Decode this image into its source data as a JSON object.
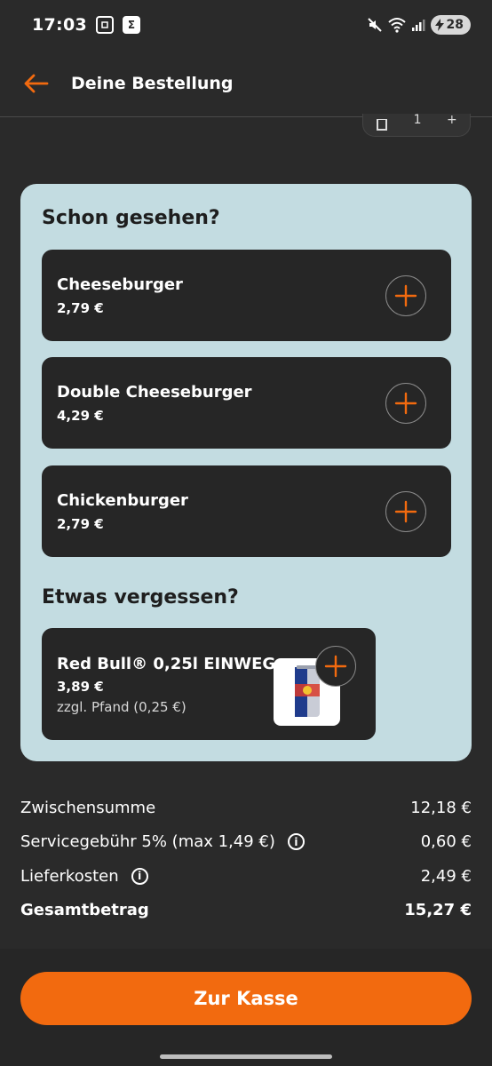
{
  "status_bar": {
    "time": "17:03",
    "battery": "28",
    "notif_icon_1": "screenshot-icon",
    "notif_icon_2": "sigma-icon"
  },
  "header": {
    "title": "Deine Bestellung"
  },
  "qty_control": {
    "value": "1",
    "minus": "-",
    "plus": "+"
  },
  "upsell": {
    "title": "Schon gesehen?",
    "items": [
      {
        "name": "Cheeseburger",
        "price": "2,79 €"
      },
      {
        "name": "Double Cheeseburger",
        "price": "4,29 €"
      },
      {
        "name": "Chickenburger",
        "price": "2,79 €"
      }
    ]
  },
  "forgot": {
    "title": "Etwas vergessen?",
    "item": {
      "name": "Red Bull® 0,25l EINWEG",
      "price": "3,89 €",
      "deposit": "zzgl. Pfand (0,25 €)"
    }
  },
  "totals": {
    "subtotal_label": "Zwischensumme",
    "subtotal_value": "12,18 €",
    "service_label": "Servicegebühr 5% (max 1,49 €)",
    "service_value": "0,60 €",
    "delivery_label": "Lieferkosten",
    "delivery_value": "2,49 €",
    "total_label": "Gesamtbetrag",
    "total_value": "15,27 €"
  },
  "checkout": {
    "label": "Zur Kasse"
  },
  "colors": {
    "accent": "#f26a0f",
    "panel": "#c3dce1",
    "background": "#2a2a2a"
  }
}
